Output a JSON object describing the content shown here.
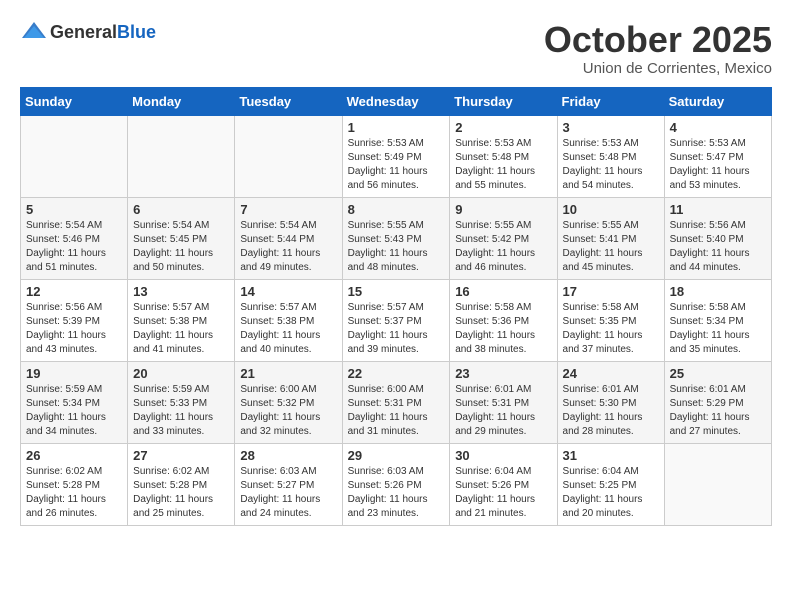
{
  "logo": {
    "general": "General",
    "blue": "Blue"
  },
  "header": {
    "month": "October 2025",
    "location": "Union de Corrientes, Mexico"
  },
  "weekdays": [
    "Sunday",
    "Monday",
    "Tuesday",
    "Wednesday",
    "Thursday",
    "Friday",
    "Saturday"
  ],
  "weeks": [
    [
      {
        "day": "",
        "info": ""
      },
      {
        "day": "",
        "info": ""
      },
      {
        "day": "",
        "info": ""
      },
      {
        "day": "1",
        "info": "Sunrise: 5:53 AM\nSunset: 5:49 PM\nDaylight: 11 hours and 56 minutes."
      },
      {
        "day": "2",
        "info": "Sunrise: 5:53 AM\nSunset: 5:48 PM\nDaylight: 11 hours and 55 minutes."
      },
      {
        "day": "3",
        "info": "Sunrise: 5:53 AM\nSunset: 5:48 PM\nDaylight: 11 hours and 54 minutes."
      },
      {
        "day": "4",
        "info": "Sunrise: 5:53 AM\nSunset: 5:47 PM\nDaylight: 11 hours and 53 minutes."
      }
    ],
    [
      {
        "day": "5",
        "info": "Sunrise: 5:54 AM\nSunset: 5:46 PM\nDaylight: 11 hours and 51 minutes."
      },
      {
        "day": "6",
        "info": "Sunrise: 5:54 AM\nSunset: 5:45 PM\nDaylight: 11 hours and 50 minutes."
      },
      {
        "day": "7",
        "info": "Sunrise: 5:54 AM\nSunset: 5:44 PM\nDaylight: 11 hours and 49 minutes."
      },
      {
        "day": "8",
        "info": "Sunrise: 5:55 AM\nSunset: 5:43 PM\nDaylight: 11 hours and 48 minutes."
      },
      {
        "day": "9",
        "info": "Sunrise: 5:55 AM\nSunset: 5:42 PM\nDaylight: 11 hours and 46 minutes."
      },
      {
        "day": "10",
        "info": "Sunrise: 5:55 AM\nSunset: 5:41 PM\nDaylight: 11 hours and 45 minutes."
      },
      {
        "day": "11",
        "info": "Sunrise: 5:56 AM\nSunset: 5:40 PM\nDaylight: 11 hours and 44 minutes."
      }
    ],
    [
      {
        "day": "12",
        "info": "Sunrise: 5:56 AM\nSunset: 5:39 PM\nDaylight: 11 hours and 43 minutes."
      },
      {
        "day": "13",
        "info": "Sunrise: 5:57 AM\nSunset: 5:38 PM\nDaylight: 11 hours and 41 minutes."
      },
      {
        "day": "14",
        "info": "Sunrise: 5:57 AM\nSunset: 5:38 PM\nDaylight: 11 hours and 40 minutes."
      },
      {
        "day": "15",
        "info": "Sunrise: 5:57 AM\nSunset: 5:37 PM\nDaylight: 11 hours and 39 minutes."
      },
      {
        "day": "16",
        "info": "Sunrise: 5:58 AM\nSunset: 5:36 PM\nDaylight: 11 hours and 38 minutes."
      },
      {
        "day": "17",
        "info": "Sunrise: 5:58 AM\nSunset: 5:35 PM\nDaylight: 11 hours and 37 minutes."
      },
      {
        "day": "18",
        "info": "Sunrise: 5:58 AM\nSunset: 5:34 PM\nDaylight: 11 hours and 35 minutes."
      }
    ],
    [
      {
        "day": "19",
        "info": "Sunrise: 5:59 AM\nSunset: 5:34 PM\nDaylight: 11 hours and 34 minutes."
      },
      {
        "day": "20",
        "info": "Sunrise: 5:59 AM\nSunset: 5:33 PM\nDaylight: 11 hours and 33 minutes."
      },
      {
        "day": "21",
        "info": "Sunrise: 6:00 AM\nSunset: 5:32 PM\nDaylight: 11 hours and 32 minutes."
      },
      {
        "day": "22",
        "info": "Sunrise: 6:00 AM\nSunset: 5:31 PM\nDaylight: 11 hours and 31 minutes."
      },
      {
        "day": "23",
        "info": "Sunrise: 6:01 AM\nSunset: 5:31 PM\nDaylight: 11 hours and 29 minutes."
      },
      {
        "day": "24",
        "info": "Sunrise: 6:01 AM\nSunset: 5:30 PM\nDaylight: 11 hours and 28 minutes."
      },
      {
        "day": "25",
        "info": "Sunrise: 6:01 AM\nSunset: 5:29 PM\nDaylight: 11 hours and 27 minutes."
      }
    ],
    [
      {
        "day": "26",
        "info": "Sunrise: 6:02 AM\nSunset: 5:28 PM\nDaylight: 11 hours and 26 minutes."
      },
      {
        "day": "27",
        "info": "Sunrise: 6:02 AM\nSunset: 5:28 PM\nDaylight: 11 hours and 25 minutes."
      },
      {
        "day": "28",
        "info": "Sunrise: 6:03 AM\nSunset: 5:27 PM\nDaylight: 11 hours and 24 minutes."
      },
      {
        "day": "29",
        "info": "Sunrise: 6:03 AM\nSunset: 5:26 PM\nDaylight: 11 hours and 23 minutes."
      },
      {
        "day": "30",
        "info": "Sunrise: 6:04 AM\nSunset: 5:26 PM\nDaylight: 11 hours and 21 minutes."
      },
      {
        "day": "31",
        "info": "Sunrise: 6:04 AM\nSunset: 5:25 PM\nDaylight: 11 hours and 20 minutes."
      },
      {
        "day": "",
        "info": ""
      }
    ]
  ]
}
